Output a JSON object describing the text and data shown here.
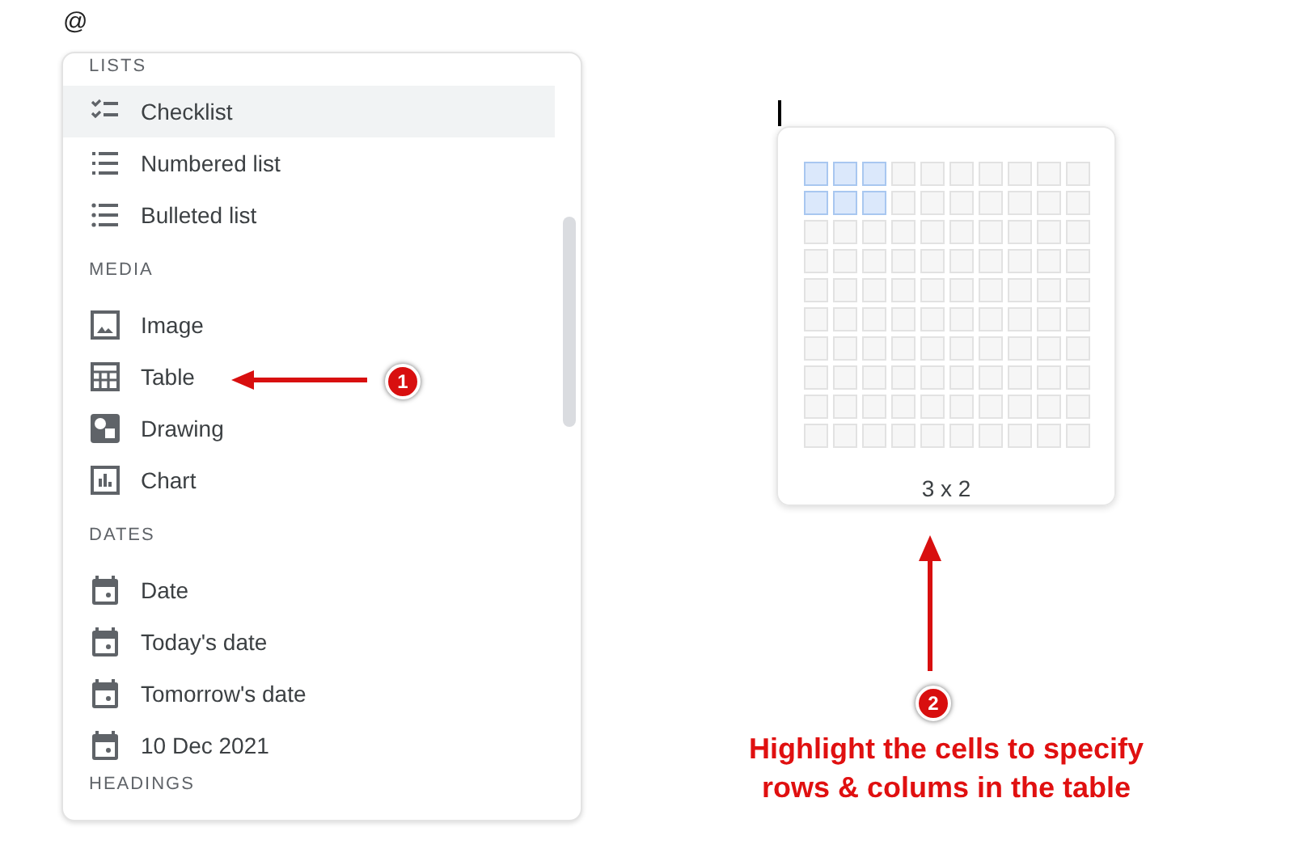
{
  "trigger": "@",
  "menu": {
    "sections": [
      {
        "heading": "LISTS",
        "items": [
          {
            "label": "Checklist",
            "kind": "checklist",
            "selected": true
          },
          {
            "label": "Numbered list",
            "kind": "numbered",
            "selected": false
          },
          {
            "label": "Bulleted list",
            "kind": "bulleted",
            "selected": false
          }
        ]
      },
      {
        "heading": "MEDIA",
        "items": [
          {
            "label": "Image",
            "kind": "image",
            "selected": false
          },
          {
            "label": "Table",
            "kind": "table",
            "selected": false
          },
          {
            "label": "Drawing",
            "kind": "drawing",
            "selected": false
          },
          {
            "label": "Chart",
            "kind": "chart",
            "selected": false
          }
        ]
      },
      {
        "heading": "DATES",
        "items": [
          {
            "label": "Date",
            "kind": "date",
            "selected": false
          },
          {
            "label": "Today's date",
            "kind": "date",
            "selected": false
          },
          {
            "label": "Tomorrow's date",
            "kind": "date",
            "selected": false
          },
          {
            "label": "10 Dec 2021",
            "kind": "date",
            "selected": false
          }
        ]
      },
      {
        "heading": "HEADINGS"
      }
    ]
  },
  "table_picker": {
    "size_label": "3 x 2",
    "rows": [
      [
        true,
        true,
        true,
        false,
        false,
        false,
        false,
        false,
        false,
        false
      ],
      [
        true,
        true,
        true,
        false,
        false,
        false,
        false,
        false,
        false,
        false
      ],
      [
        false,
        false,
        false,
        false,
        false,
        false,
        false,
        false,
        false,
        false
      ],
      [
        false,
        false,
        false,
        false,
        false,
        false,
        false,
        false,
        false,
        false
      ],
      [
        false,
        false,
        false,
        false,
        false,
        false,
        false,
        false,
        false,
        false
      ],
      [
        false,
        false,
        false,
        false,
        false,
        false,
        false,
        false,
        false,
        false
      ],
      [
        false,
        false,
        false,
        false,
        false,
        false,
        false,
        false,
        false,
        false
      ],
      [
        false,
        false,
        false,
        false,
        false,
        false,
        false,
        false,
        false,
        false
      ],
      [
        false,
        false,
        false,
        false,
        false,
        false,
        false,
        false,
        false,
        false
      ],
      [
        false,
        false,
        false,
        false,
        false,
        false,
        false,
        false,
        false,
        false
      ]
    ]
  },
  "annotations": [
    {
      "badge": "1"
    },
    {
      "badge": "2",
      "caption": "Highlight the cells to specify rows & colums in the table"
    }
  ]
}
